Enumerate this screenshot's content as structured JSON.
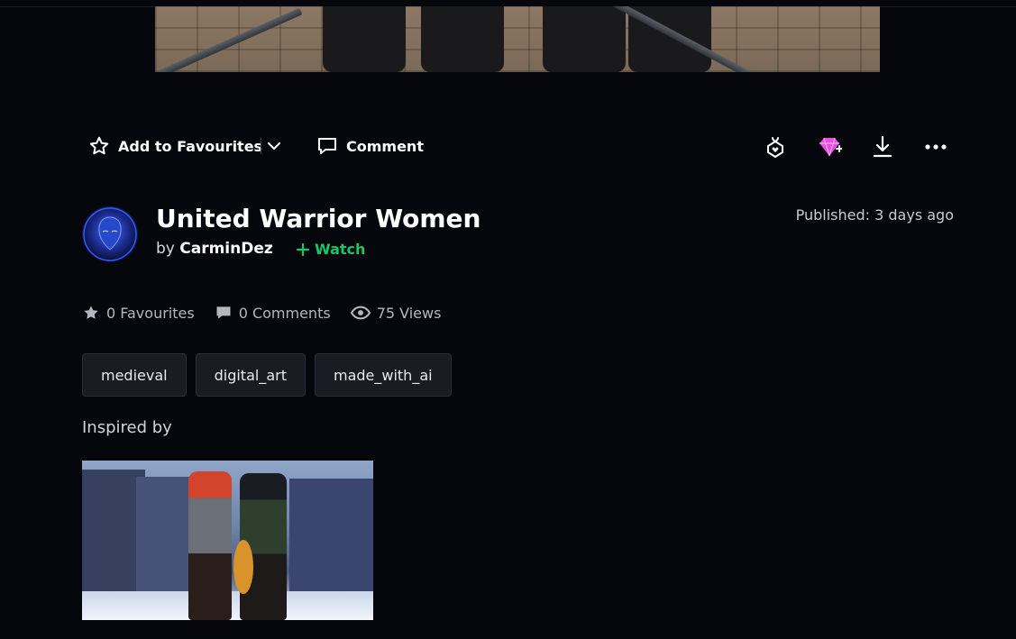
{
  "actions": {
    "favourite_label": "Add to Favourites",
    "comment_label": "Comment"
  },
  "deviation": {
    "title": "United Warrior Women",
    "by_prefix": "by",
    "author": "CarminDez",
    "watch_label": "Watch",
    "published_label": "Published:",
    "published_value": "3 days ago"
  },
  "stats": {
    "favourites": "0 Favourites",
    "comments": "0 Comments",
    "views": "75 Views"
  },
  "tags": [
    "medieval",
    "digital_art",
    "made_with_ai"
  ],
  "inspired": {
    "heading": "Inspired by"
  },
  "colors": {
    "background": "#06070d",
    "watch_green": "#15c867",
    "gem_pink": "#e84fe0"
  },
  "icons": [
    "star-outline-icon",
    "chevron-down-icon",
    "comment-bubble-icon",
    "gift-badge-icon",
    "gem-icon",
    "download-icon",
    "more-icon",
    "star-icon",
    "comment-icon",
    "eye-icon",
    "plus-icon"
  ]
}
